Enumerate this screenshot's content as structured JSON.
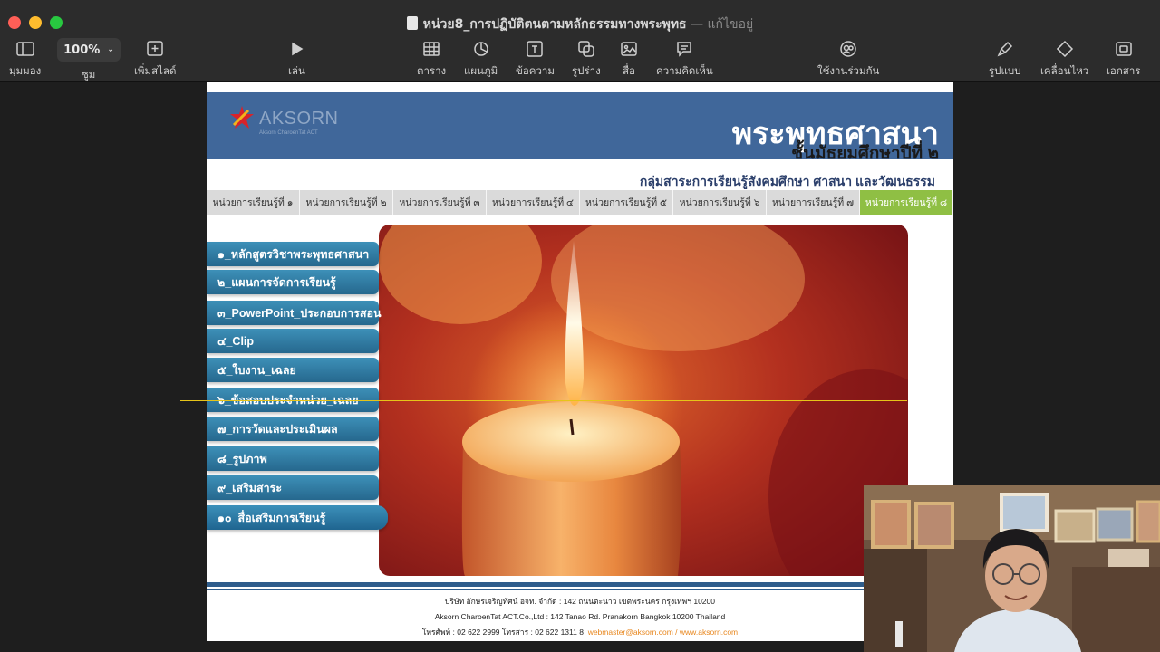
{
  "window": {
    "title": "หน่วย8_การปฏิบัติตนตามหลักธรรมทางพระพุทธ",
    "separator": "—",
    "state": "แก้ไขอยู่"
  },
  "toolbar": {
    "view_label": "มุมมอง",
    "zoom_value": "100%",
    "zoom_label": "ซูม",
    "add_slide_label": "เพิ่มสไลด์",
    "play_label": "เล่น",
    "table_label": "ตาราง",
    "chart_label": "แผนภูมิ",
    "text_label": "ข้อความ",
    "shape_label": "รูปร่าง",
    "media_label": "สื่อ",
    "comment_label": "ความคิดเห็น",
    "collaborate_label": "ใช้งานร่วมกัน",
    "format_label": "รูปแบบ",
    "animate_label": "เคลื่อนไหว",
    "document_label": "เอกสาร"
  },
  "slide": {
    "logo_text": "AKSORN",
    "logo_subtext": "Aksorn CharoenTat ACT",
    "title": "พระพุทธศาสนา",
    "subtitle": "ชั้นมัธยมศึกษาปีที่ ๒",
    "group": "กลุ่มสาระการเรียนรู้สังคมศึกษา ศาสนา และวัฒนธรรม",
    "tabs": [
      "หน่วยการเรียนรู้ที่ ๑",
      "หน่วยการเรียนรู้ที่ ๒",
      "หน่วยการเรียนรู้ที่ ๓",
      "หน่วยการเรียนรู้ที่ ๔",
      "หน่วยการเรียนรู้ที่ ๕",
      "หน่วยการเรียนรู้ที่ ๖",
      "หน่วยการเรียนรู้ที่ ๗",
      "หน่วยการเรียนรู้ที่ ๘"
    ],
    "active_tab": 8,
    "menu": [
      "๑_หลักสูตรวิชาพระพุทธศาสนา",
      "๒_แผนการจัดการเรียนรู้",
      "๓_PowerPoint_ประกอบการสอน",
      "๔_Clip",
      "๕_ใบงาน_เฉลย",
      "๖_ข้อสอบประจำหน่วย_เฉลย",
      "๗_การวัดและประเมินผล",
      "๘_รูปภาพ",
      "๙_เสริมสาระ",
      "๑๐_สื่อเสริมการเรียนรู้"
    ],
    "footer_line1": "บริษัท อักษรเจริญทัศน์ อจท. จำกัด : 142 ถนนตะนาว เขตพระนคร กรุงเทพฯ 10200",
    "footer_line2": "Aksorn CharoenTat ACT.Co.,Ltd : 142 Tanao Rd. Pranakorn Bangkok 10200 Thailand",
    "footer_line3": "โทรศัพท์ : 02 622 2999  โทรสาร : 02 622 1311 8",
    "footer_web": "webmaster@aksorn.com / www.aksorn.com"
  },
  "colors": {
    "header": "#40679a",
    "tab_active": "#8fbf44",
    "menu": "#2f7aa3",
    "guide": "#e6c419"
  }
}
